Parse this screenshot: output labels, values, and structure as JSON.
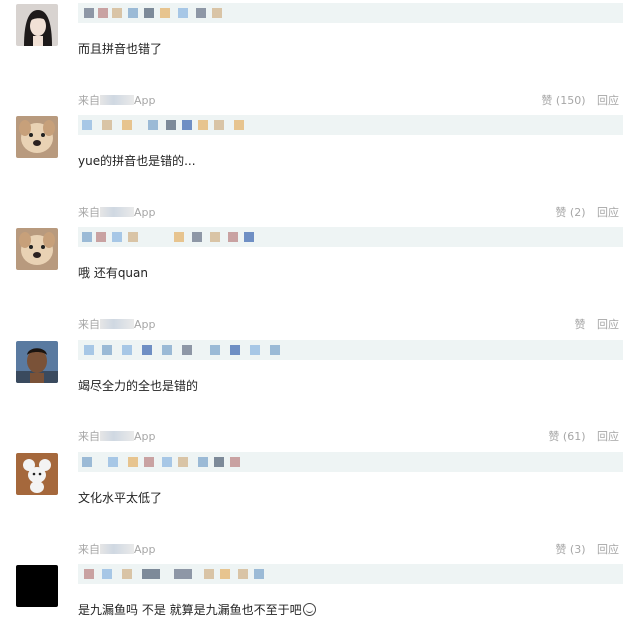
{
  "comments": [
    {
      "text": "而且拼音也错了",
      "meta": {
        "source": "来自",
        "source_suffix": "App",
        "like": "赞 (150)",
        "reply": "回应"
      }
    },
    {
      "text": "yue的拼音也是错的...",
      "meta": {
        "source": "来自",
        "source_suffix": "App",
        "like": "赞 (2)",
        "reply": "回应"
      }
    },
    {
      "text": "哦 还有quan",
      "meta": {
        "source": "来自",
        "source_suffix": "App",
        "like": "赞",
        "reply": "回应"
      }
    },
    {
      "text": "竭尽全力的全也是错的",
      "meta": {
        "source": "来自",
        "source_suffix": "App",
        "like": "赞 (61)",
        "reply": "回应"
      }
    },
    {
      "text": "文化水平太低了",
      "meta": {
        "source": "来自",
        "source_suffix": "App",
        "like": "赞 (3)",
        "reply": "回应"
      }
    },
    {
      "text": "是九漏鱼吗 不是 就算是九漏鱼也不至于吧",
      "emoji": "smile-emoji-icon"
    }
  ],
  "colors": {
    "namebar_bg": "#eef4f4",
    "meta_text": "#a6a6a6",
    "comment_text": "#222222",
    "pixel_palette": [
      "#8e97a6",
      "#d9c4a6",
      "#6f8fc4",
      "#a7c7e6",
      "#c9a2a2",
      "#7d8a99",
      "#e7c48f",
      "#9bbad6"
    ]
  }
}
